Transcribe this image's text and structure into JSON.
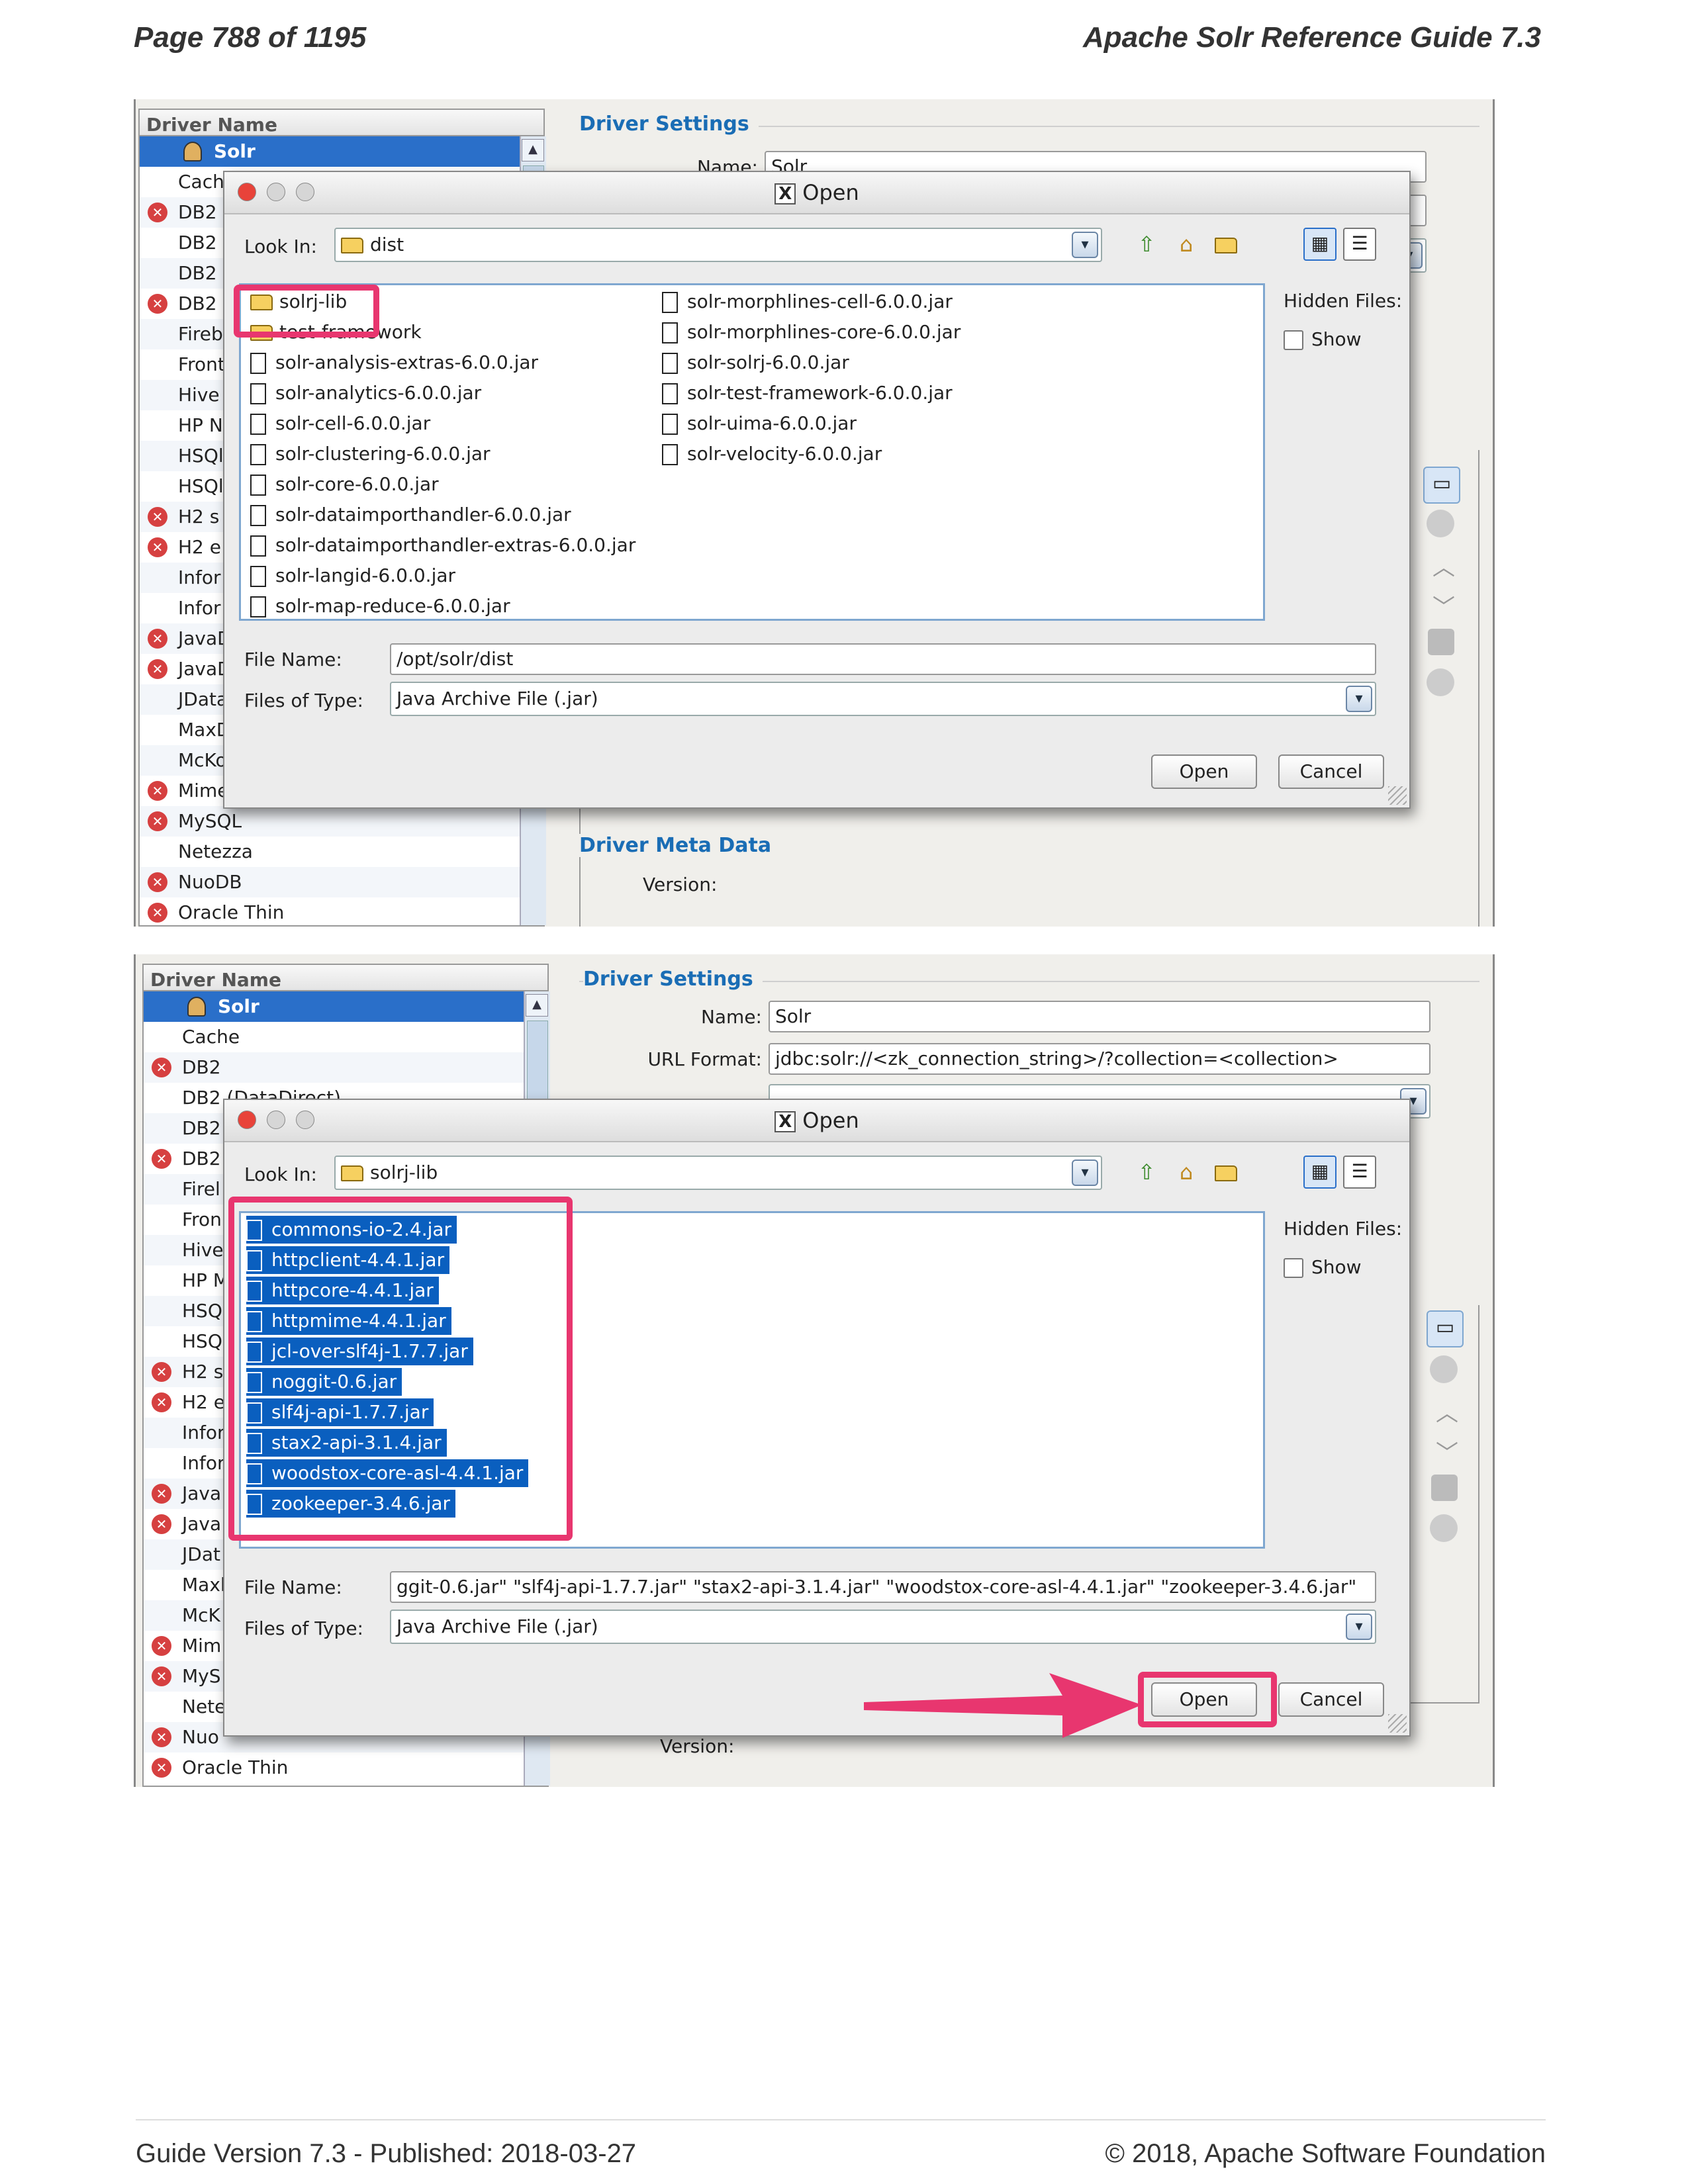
{
  "page": {
    "header_left": "Page 788 of 1195",
    "header_right": "Apache Solr Reference Guide 7.3",
    "footer_left": "Guide Version 7.3 - Published: 2018-03-27",
    "footer_right": "© 2018, Apache Software Foundation"
  },
  "shot1": {
    "driver_column": "Driver Name",
    "drivers": [
      {
        "label": "Solr",
        "selected": true,
        "error": false
      },
      {
        "label": "Cach",
        "error": false
      },
      {
        "label": "DB2",
        "error": true
      },
      {
        "label": "DB2",
        "error": false
      },
      {
        "label": "DB2",
        "error": false
      },
      {
        "label": "DB2 :",
        "error": true
      },
      {
        "label": "Fireb",
        "error": false
      },
      {
        "label": "Front",
        "error": false
      },
      {
        "label": "Hive",
        "error": false
      },
      {
        "label": "HP N",
        "error": false
      },
      {
        "label": "HSQl",
        "error": false
      },
      {
        "label": "HSQl",
        "error": false
      },
      {
        "label": "H2 s",
        "error": true
      },
      {
        "label": "H2 e",
        "error": true
      },
      {
        "label": "Infor",
        "error": false
      },
      {
        "label": "Infor",
        "error": false
      },
      {
        "label": "JavaD",
        "error": true
      },
      {
        "label": "JavaD",
        "error": true
      },
      {
        "label": "JData",
        "error": false
      },
      {
        "label": "MaxD",
        "error": false
      },
      {
        "label": "McKo",
        "error": false
      },
      {
        "label": "Mime",
        "error": true
      },
      {
        "label": "MySQL",
        "error": true
      },
      {
        "label": "Netezza",
        "error": false
      },
      {
        "label": "NuoDB",
        "error": true
      },
      {
        "label": "Oracle Thin",
        "error": true
      }
    ],
    "settings_heading": "Driver Settings",
    "name_label": "Name:",
    "name_value": "Solr",
    "meta_heading": "Driver Meta Data",
    "version_label": "Version:",
    "dialog": {
      "title": "Open",
      "look_in_label": "Look In:",
      "look_in_value": "dist",
      "hidden_files_label": "Hidden Files:",
      "show_label": "Show",
      "files_left": [
        {
          "name": "solrj-lib",
          "folder": true
        },
        {
          "name": "test-framework",
          "folder": true
        },
        {
          "name": "solr-analysis-extras-6.0.0.jar"
        },
        {
          "name": "solr-analytics-6.0.0.jar"
        },
        {
          "name": "solr-cell-6.0.0.jar"
        },
        {
          "name": "solr-clustering-6.0.0.jar"
        },
        {
          "name": "solr-core-6.0.0.jar"
        },
        {
          "name": "solr-dataimporthandler-6.0.0.jar"
        },
        {
          "name": "solr-dataimporthandler-extras-6.0.0.jar"
        },
        {
          "name": "solr-langid-6.0.0.jar"
        },
        {
          "name": "solr-map-reduce-6.0.0.jar"
        }
      ],
      "files_right": [
        {
          "name": "solr-morphlines-cell-6.0.0.jar"
        },
        {
          "name": "solr-morphlines-core-6.0.0.jar"
        },
        {
          "name": "solr-solrj-6.0.0.jar"
        },
        {
          "name": "solr-test-framework-6.0.0.jar"
        },
        {
          "name": "solr-uima-6.0.0.jar"
        },
        {
          "name": "solr-velocity-6.0.0.jar"
        }
      ],
      "file_name_label": "File Name:",
      "file_name_value": "/opt/solr/dist",
      "files_type_label": "Files of Type:",
      "files_type_value": "Java Archive File (.jar)",
      "open_label": "Open",
      "cancel_label": "Cancel"
    }
  },
  "shot2": {
    "driver_column": "Driver Name",
    "drivers": [
      {
        "label": "Solr",
        "selected": true,
        "error": false
      },
      {
        "label": "Cache",
        "error": false
      },
      {
        "label": "DB2",
        "error": true
      },
      {
        "label": "DB2 (DataDirect)",
        "error": false
      },
      {
        "label": "DB2",
        "error": false
      },
      {
        "label": "DB2",
        "error": true
      },
      {
        "label": "Firel",
        "error": false
      },
      {
        "label": "Fron",
        "error": false
      },
      {
        "label": "Hive",
        "error": false
      },
      {
        "label": "HP M",
        "error": false
      },
      {
        "label": "HSQ",
        "error": false
      },
      {
        "label": "HSQ",
        "error": false
      },
      {
        "label": "H2 s",
        "error": true
      },
      {
        "label": "H2 e",
        "error": true
      },
      {
        "label": "Infor",
        "error": false
      },
      {
        "label": "Infor",
        "error": false
      },
      {
        "label": "Java",
        "error": true
      },
      {
        "label": "Java",
        "error": true
      },
      {
        "label": "JDat",
        "error": false
      },
      {
        "label": "Maxl",
        "error": false
      },
      {
        "label": "McK",
        "error": false
      },
      {
        "label": "Mim",
        "error": true
      },
      {
        "label": "MyS",
        "error": true
      },
      {
        "label": "Nete",
        "error": false
      },
      {
        "label": "Nuo",
        "error": true
      },
      {
        "label": "Oracle Thin",
        "error": true
      }
    ],
    "settings_heading": "Driver Settings",
    "name_label": "Name:",
    "name_value": "Solr",
    "url_label": "URL Format:",
    "url_value": "jdbc:solr://<zk_connection_string>/?collection=<collection>",
    "version_label": "Version:",
    "dialog": {
      "title": "Open",
      "look_in_label": "Look In:",
      "look_in_value": "solrj-lib",
      "hidden_files_label": "Hidden Files:",
      "show_label": "Show",
      "files": [
        "commons-io-2.4.jar",
        "httpclient-4.4.1.jar",
        "httpcore-4.4.1.jar",
        "httpmime-4.4.1.jar",
        "jcl-over-slf4j-1.7.7.jar",
        "noggit-0.6.jar",
        "slf4j-api-1.7.7.jar",
        "stax2-api-3.1.4.jar",
        "woodstox-core-asl-4.4.1.jar",
        "zookeeper-3.4.6.jar"
      ],
      "file_name_label": "File Name:",
      "file_name_value": "ggit-0.6.jar\" \"slf4j-api-1.7.7.jar\" \"stax2-api-3.1.4.jar\" \"woodstox-core-asl-4.4.1.jar\" \"zookeeper-3.4.6.jar\"",
      "files_type_label": "Files of Type:",
      "files_type_value": "Java Archive File (.jar)",
      "open_label": "Open",
      "cancel_label": "Cancel"
    }
  },
  "colors": {
    "highlight": "#e8366f",
    "selection": "#0a5fbf",
    "heading": "#1a6db5"
  }
}
